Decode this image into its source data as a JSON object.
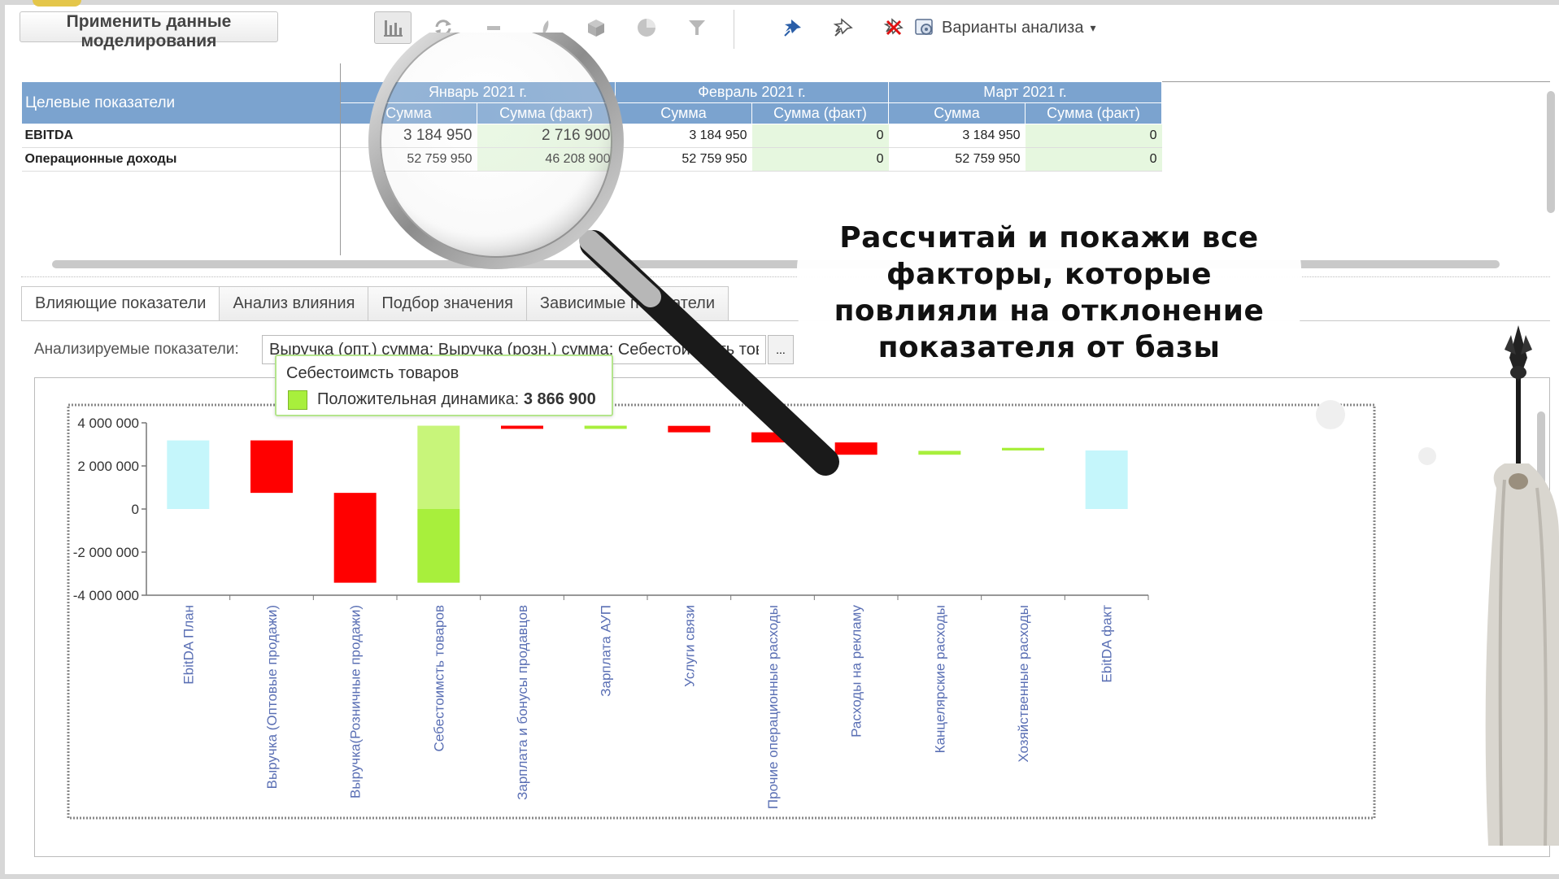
{
  "toolbar": {
    "apply_label": "Применить данные моделирования",
    "variants_label": "Варианты анализа",
    "variants_caret": "▾",
    "icons": [
      "chart-icon",
      "refresh-icon",
      "minus-icon",
      "leaf-icon",
      "cube-icon",
      "pie-icon",
      "filter-icon",
      "pin-icon",
      "pin-outline-icon",
      "unpin-icon",
      "settings-icon"
    ]
  },
  "pivot": {
    "row_header": "Целевые показатели",
    "months": [
      "Январь 2021 г.",
      "Февраль 2021 г.",
      "Март 2021 г."
    ],
    "col_sum": "Сумма",
    "col_fact": "Сумма (факт)",
    "rows": [
      {
        "name": "EBITDA",
        "values": [
          "3 184 950",
          "2 716 900",
          "3 184 950",
          "0",
          "3 184 950",
          "0"
        ]
      },
      {
        "name": "Операционные доходы",
        "values": [
          "52 759 950",
          "46 208 900",
          "52 759 950",
          "0",
          "52 759 950",
          "0"
        ]
      }
    ]
  },
  "tabs": [
    {
      "label": "Влияющие показатели"
    },
    {
      "label": "Анализ влияния"
    },
    {
      "label": "Подбор значения"
    },
    {
      "label": "Зависимые показатели"
    }
  ],
  "analyzed": {
    "label": "Анализируемые показатели:",
    "value": "Выручка (опт.) сумма; Выручка (розн.) сумма; Себестоимость товаров",
    "button": "..."
  },
  "tooltip": {
    "title": "Себестоимсть товаров",
    "label": "Положительная динамика:",
    "value": "3 866 900"
  },
  "callout": {
    "line1": "Рассчитай и покажи все",
    "line2": "факторы, которые",
    "line3": "повлияли на отклонение",
    "line4": "показателя от базы"
  },
  "colors": {
    "header_blue": "#7ba3cf",
    "fact_green": "#e6f7df",
    "base_cyan": "#c5f6fb",
    "negative_red": "#ff0000",
    "positive_green": "#a8ef3c"
  },
  "chart_data": {
    "type": "bar",
    "subtype": "waterfall",
    "ylim": [
      -4000000,
      4000000
    ],
    "yticks": [
      4000000,
      2000000,
      0,
      -2000000,
      -4000000
    ],
    "ytick_labels": [
      "4 000 000",
      "2 000 000",
      "0",
      "-2 000 000",
      "-4 000 000"
    ],
    "categories": [
      "EbitDA План",
      "Выручка (Оптовые продажи)",
      "Выручка(Розничные продажи)",
      "Себестоимсть товаров",
      "Зарплата и бонусы продавцов",
      "Зарплата АУП",
      "Услуги связи",
      "Прочие операционные расходы",
      "Расходы на рекламу",
      "Канцелярские расходы",
      "Хозяйственные расходы",
      "EbitDA факт"
    ],
    "bars": [
      {
        "low": 0,
        "high": 3184950,
        "kind": "base"
      },
      {
        "low": 750000,
        "high": 3184950,
        "kind": "negative"
      },
      {
        "low": -3420000,
        "high": 750000,
        "kind": "negative"
      },
      {
        "low": -3420000,
        "high": 3866900,
        "kind": "positive",
        "split_at": 0
      },
      {
        "low": 3720000,
        "high": 3866900,
        "kind": "negative"
      },
      {
        "low": 3720000,
        "high": 3866900,
        "kind": "positive"
      },
      {
        "low": 3560000,
        "high": 3860000,
        "kind": "negative"
      },
      {
        "low": 3090000,
        "high": 3560000,
        "kind": "negative"
      },
      {
        "low": 2520000,
        "high": 3090000,
        "kind": "negative"
      },
      {
        "low": 2520000,
        "high": 2700000,
        "kind": "positive"
      },
      {
        "low": 2716900,
        "high": 2840000,
        "kind": "positive"
      },
      {
        "low": 0,
        "high": 2716900,
        "kind": "base"
      }
    ],
    "grid": false,
    "legend": "none"
  }
}
